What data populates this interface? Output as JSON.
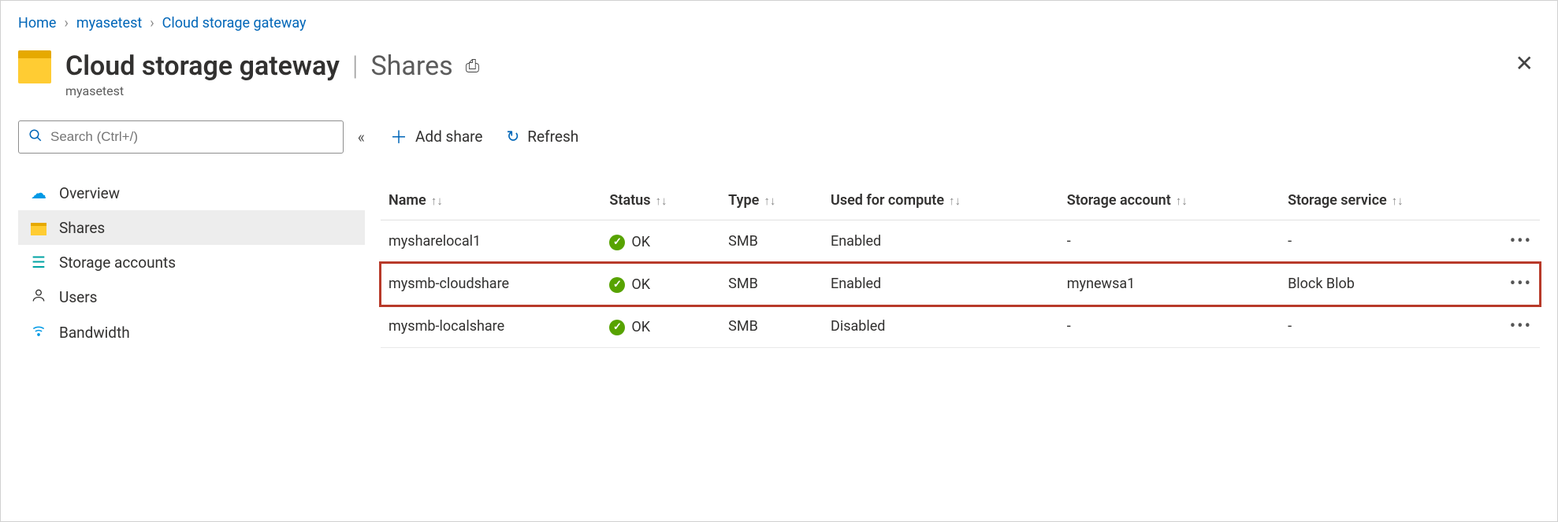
{
  "breadcrumb": [
    "Home",
    "myasetest",
    "Cloud storage gateway"
  ],
  "header": {
    "title": "Cloud storage gateway",
    "section": "Shares",
    "subtitle": "myasetest"
  },
  "search": {
    "placeholder": "Search (Ctrl+/)"
  },
  "nav": {
    "items": [
      {
        "label": "Overview",
        "icon": "cloud",
        "active": false
      },
      {
        "label": "Shares",
        "icon": "folder",
        "active": true
      },
      {
        "label": "Storage accounts",
        "icon": "storage",
        "active": false
      },
      {
        "label": "Users",
        "icon": "user",
        "active": false
      },
      {
        "label": "Bandwidth",
        "icon": "wifi",
        "active": false
      }
    ]
  },
  "commands": {
    "add": "Add share",
    "refresh": "Refresh"
  },
  "table": {
    "columns": [
      "Name",
      "Status",
      "Type",
      "Used for compute",
      "Storage account",
      "Storage service"
    ],
    "rows": [
      {
        "name": "mysharelocal1",
        "status": "OK",
        "type": "SMB",
        "compute": "Enabled",
        "account": "-",
        "service": "-",
        "highlight": false
      },
      {
        "name": "mysmb-cloudshare",
        "status": "OK",
        "type": "SMB",
        "compute": "Enabled",
        "account": "mynewsa1",
        "service": "Block Blob",
        "highlight": true
      },
      {
        "name": "mysmb-localshare",
        "status": "OK",
        "type": "SMB",
        "compute": "Disabled",
        "account": "-",
        "service": "-",
        "highlight": false
      }
    ]
  }
}
